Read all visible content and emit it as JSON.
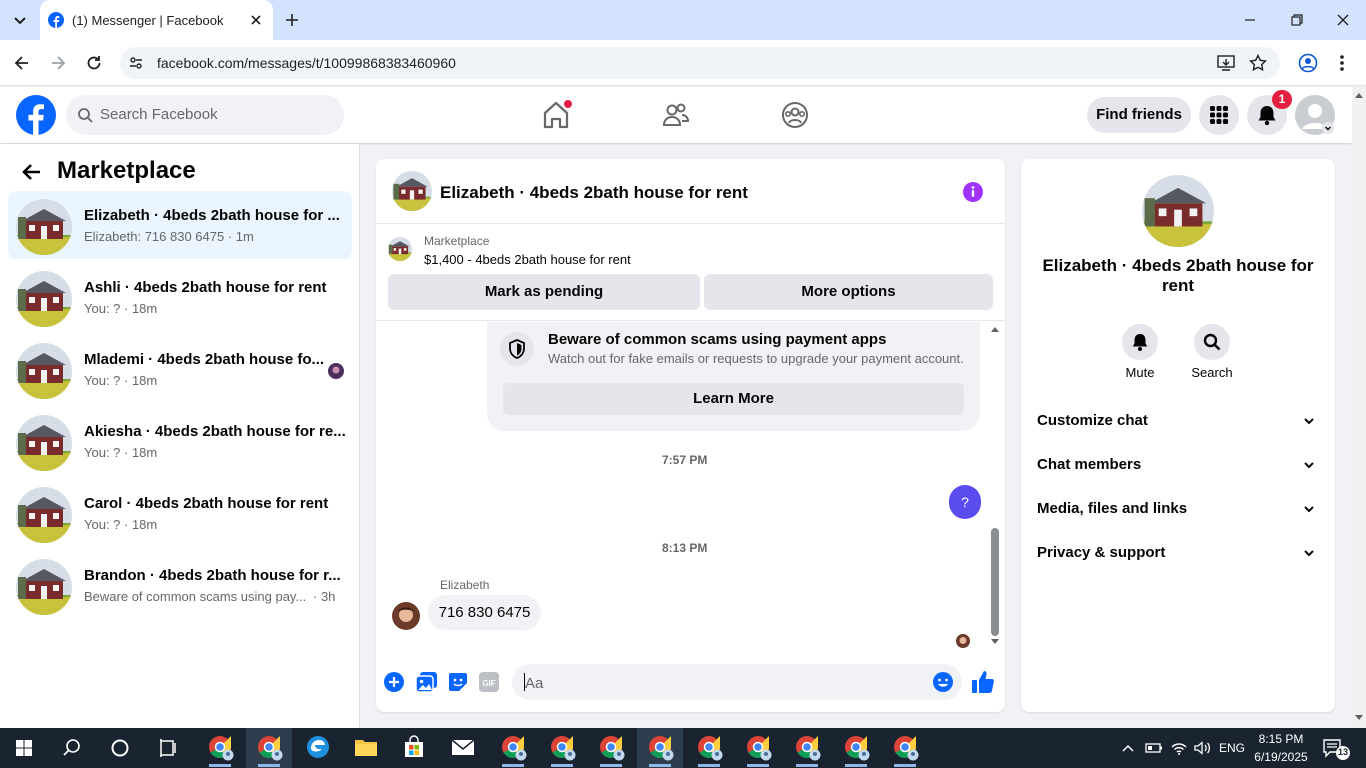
{
  "browser": {
    "tab_title": "(1) Messenger | Facebook",
    "url": "facebook.com/messages/t/10099868383460960"
  },
  "header": {
    "search_placeholder": "Search Facebook",
    "find_friends": "Find friends",
    "notification_count": "1"
  },
  "sidebar": {
    "title": "Marketplace",
    "conversations": [
      {
        "name": "Elizabeth · 4beds 2bath house for ...",
        "preview": "Elizabeth: 716 830 6475 · 1m"
      },
      {
        "name": "Ashli · 4beds 2bath house for rent",
        "preview": "You: ? · 18m"
      },
      {
        "name": "Mlademi · 4beds 2bath house fo...",
        "preview": "You: ? · 18m"
      },
      {
        "name": "Akiesha · 4beds 2bath house for re...",
        "preview": "You: ? · 18m"
      },
      {
        "name": "Carol · 4beds 2bath house for rent",
        "preview": "You: ? · 18m"
      },
      {
        "name": "Brandon · 4beds 2bath house for r...",
        "preview": "Beware of common scams using pay...",
        "time": "· 3h"
      }
    ]
  },
  "chat": {
    "title": "Elizabeth · 4beds 2bath house for rent",
    "marketplace_label": "Marketplace",
    "listing": "$1,400 - 4beds 2bath house for rent",
    "mark_pending": "Mark as pending",
    "more_options": "More options",
    "scam_title": "Beware of common scams using payment apps",
    "scam_desc": "Watch out for fake emails or requests to upgrade your payment account.",
    "learn_more": "Learn More",
    "time1": "7:57 PM",
    "my_message": "?",
    "time2": "8:13 PM",
    "sender": "Elizabeth",
    "their_message": "716 830 6475",
    "composer_placeholder": "Aa"
  },
  "details": {
    "name": "Elizabeth · 4beds 2bath house for rent",
    "mute": "Mute",
    "search": "Search",
    "rows": [
      "Customize chat",
      "Chat members",
      "Media, files and links",
      "Privacy & support"
    ]
  },
  "taskbar": {
    "time": "8:15 PM",
    "date": "6/19/2025",
    "lang": "ENG",
    "notif_count": "13"
  },
  "colors": {
    "fb_blue": "#0866ff",
    "messenger_purple": "#5b4cf0",
    "badge_red": "#e41e3f"
  }
}
